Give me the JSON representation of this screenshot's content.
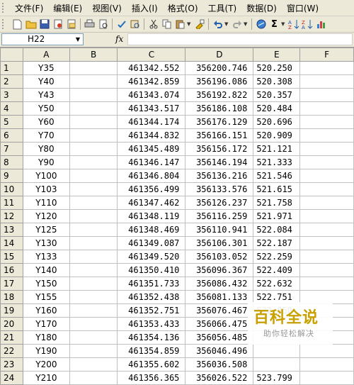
{
  "menu": [
    "文件(F)",
    "编辑(E)",
    "视图(V)",
    "插入(I)",
    "格式(O)",
    "工具(T)",
    "数据(D)",
    "窗口(W)"
  ],
  "toolbar": {
    "icons": [
      "new-file-icon",
      "open-folder-icon",
      "save-icon",
      "permission-icon",
      "email-icon",
      "print-icon",
      "print-preview-icon",
      "spelling-icon",
      "research-icon",
      "cut-icon",
      "copy-icon",
      "paste-icon",
      "format-painter-icon",
      "undo-icon",
      "redo-icon",
      "hyperlink-icon",
      "autosum-icon",
      "sort-ascending-icon",
      "sort-descending-icon",
      "chart-icon"
    ]
  },
  "formula_bar": {
    "name_box": "H22",
    "fx": "fx",
    "formula": ""
  },
  "columns": [
    "A",
    "B",
    "C",
    "D",
    "E",
    "F"
  ],
  "rows": [
    {
      "n": "1",
      "a": "Y35",
      "b": "",
      "c": "461342.552",
      "d": "356200.746",
      "e": "520.250",
      "f": ""
    },
    {
      "n": "2",
      "a": "Y40",
      "b": "",
      "c": "461342.859",
      "d": "356196.086",
      "e": "520.308",
      "f": ""
    },
    {
      "n": "3",
      "a": "Y43",
      "b": "",
      "c": "461343.074",
      "d": "356192.822",
      "e": "520.357",
      "f": ""
    },
    {
      "n": "4",
      "a": "Y50",
      "b": "",
      "c": "461343.517",
      "d": "356186.108",
      "e": "520.484",
      "f": ""
    },
    {
      "n": "5",
      "a": "Y60",
      "b": "",
      "c": "461344.174",
      "d": "356176.129",
      "e": "520.696",
      "f": ""
    },
    {
      "n": "6",
      "a": "Y70",
      "b": "",
      "c": "461344.832",
      "d": "356166.151",
      "e": "520.909",
      "f": ""
    },
    {
      "n": "7",
      "a": "Y80",
      "b": "",
      "c": "461345.489",
      "d": "356156.172",
      "e": "521.121",
      "f": ""
    },
    {
      "n": "8",
      "a": "Y90",
      "b": "",
      "c": "461346.147",
      "d": "356146.194",
      "e": "521.333",
      "f": ""
    },
    {
      "n": "9",
      "a": "Y100",
      "b": "",
      "c": "461346.804",
      "d": "356136.216",
      "e": "521.546",
      "f": ""
    },
    {
      "n": "10",
      "a": "Y103",
      "b": "",
      "c": "461356.499",
      "d": "356133.576",
      "e": "521.615",
      "f": ""
    },
    {
      "n": "11",
      "a": "Y110",
      "b": "",
      "c": "461347.462",
      "d": "356126.237",
      "e": "521.758",
      "f": ""
    },
    {
      "n": "12",
      "a": "Y120",
      "b": "",
      "c": "461348.119",
      "d": "356116.259",
      "e": "521.971",
      "f": ""
    },
    {
      "n": "13",
      "a": "Y125",
      "b": "",
      "c": "461348.469",
      "d": "356110.941",
      "e": "522.084",
      "f": ""
    },
    {
      "n": "14",
      "a": "Y130",
      "b": "",
      "c": "461349.087",
      "d": "356106.301",
      "e": "522.187",
      "f": ""
    },
    {
      "n": "15",
      "a": "Y133",
      "b": "",
      "c": "461349.520",
      "d": "356103.052",
      "e": "522.259",
      "f": ""
    },
    {
      "n": "16",
      "a": "Y140",
      "b": "",
      "c": "461350.410",
      "d": "356096.367",
      "e": "522.409",
      "f": ""
    },
    {
      "n": "17",
      "a": "Y150",
      "b": "",
      "c": "461351.733",
      "d": "356086.432",
      "e": "522.632",
      "f": ""
    },
    {
      "n": "18",
      "a": "Y155",
      "b": "",
      "c": "461352.438",
      "d": "356081.133",
      "e": "522.751",
      "f": ""
    },
    {
      "n": "19",
      "a": "Y160",
      "b": "",
      "c": "461352.751",
      "d": "356076.467",
      "e": "522.850",
      "f": ""
    },
    {
      "n": "20",
      "a": "Y170",
      "b": "",
      "c": "461353.433",
      "d": "356066.475",
      "e": "",
      "f": ""
    },
    {
      "n": "21",
      "a": "Y180",
      "b": "",
      "c": "461354.136",
      "d": "356056.485",
      "e": "",
      "f": ""
    },
    {
      "n": "22",
      "a": "Y190",
      "b": "",
      "c": "461354.859",
      "d": "356046.496",
      "e": "",
      "f": ""
    },
    {
      "n": "23",
      "a": "Y200",
      "b": "",
      "c": "461355.602",
      "d": "356036.508",
      "e": "",
      "f": ""
    },
    {
      "n": "24",
      "a": "Y210",
      "b": "",
      "c": "461356.365",
      "d": "356026.522",
      "e": "523.799",
      "f": ""
    }
  ],
  "watermark": {
    "title": "百科全说",
    "subtitle": "助你轻松解决"
  },
  "colors": {
    "chrome": "#ece9d8",
    "grid": "#c0c0c0",
    "watermark": "#c8a000"
  }
}
